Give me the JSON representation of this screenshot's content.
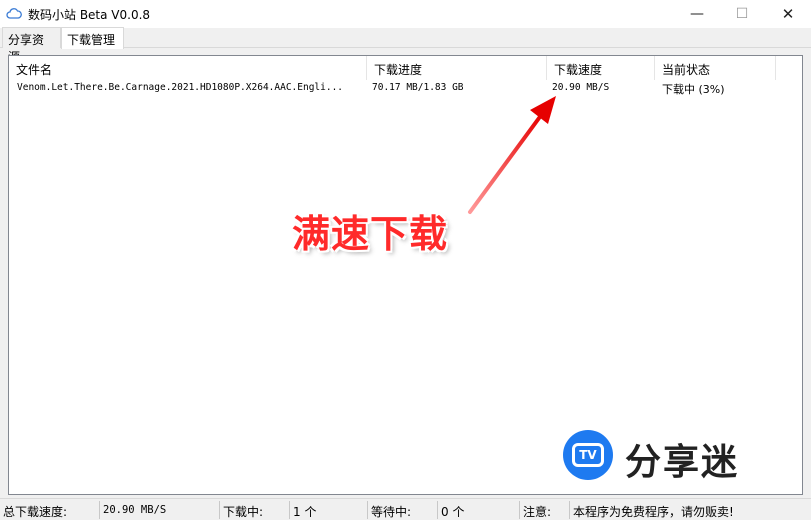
{
  "window": {
    "title": "数码小站 Beta V0.0.8",
    "minimize": "—",
    "maximize": "☐",
    "close": "✕"
  },
  "tabs": [
    {
      "label": "分享资源",
      "active": false
    },
    {
      "label": "下载管理",
      "active": true
    }
  ],
  "table": {
    "columns": [
      "文件名",
      "下载进度",
      "下载速度",
      "当前状态"
    ],
    "rows": [
      {
        "filename": "Venom.Let.There.Be.Carnage.2021.HD1080P.X264.AAC.Engli...",
        "progress": "70.17 MB/1.83 GB",
        "speed": "20.90 MB/S",
        "status": "下载中 (3%)"
      }
    ]
  },
  "annotation": {
    "text": "满速下载",
    "color": "#ff2a2a"
  },
  "watermark": {
    "logo_text": "TV",
    "text": "分享迷",
    "color": "#1e7af0"
  },
  "statusbar": {
    "total_speed_label": "总下载速度:",
    "total_speed_value": "20.90 MB/S",
    "downloading_label": "下载中:",
    "downloading_value": "1 个",
    "waiting_label": "等待中:",
    "waiting_value": "0 个",
    "note_label": "注意:",
    "note_value": "本程序为免费程序，请勿贩卖!"
  }
}
